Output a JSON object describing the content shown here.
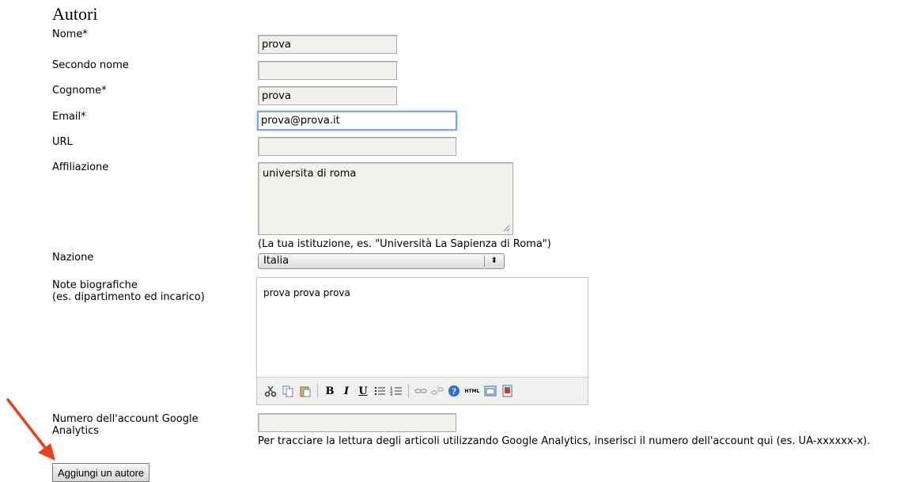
{
  "section": {
    "title": "Autori"
  },
  "fields": {
    "first_name": {
      "label": "Nome*",
      "value": "prova"
    },
    "middle_name": {
      "label": "Secondo nome",
      "value": ""
    },
    "last_name": {
      "label": "Cognome*",
      "value": "prova"
    },
    "email": {
      "label": "Email*",
      "value": "prova@prova.it"
    },
    "url": {
      "label": "URL",
      "value": ""
    },
    "affiliation": {
      "label": "Affiliazione",
      "value": "universita di roma",
      "hint": "(La tua istituzione, es. \"Università La Sapienza di Roma\")"
    },
    "country": {
      "label": "Nazione",
      "selected": "Italia"
    },
    "bio": {
      "label_line1": "Note biografiche",
      "label_line2": "(es. dipartimento ed incarico)",
      "value": "prova prova prova"
    },
    "analytics": {
      "label_line1": "Numero dell'account Google",
      "label_line2": "Analytics",
      "value": "",
      "hint": "Per tracciare la lettura degli articoli utilizzando Google Analytics, inserisci il numero dell'account qui (es. UA-xxxxxx-x)."
    }
  },
  "editor_toolbar": {
    "icons": [
      "cut-icon",
      "copy-icon",
      "paste-icon",
      "bold-icon",
      "italic-icon",
      "underline-icon",
      "bullet-list-icon",
      "numbered-list-icon",
      "link-icon",
      "unlink-icon",
      "help-icon",
      "html-icon",
      "fullscreen-icon",
      "insert-image-icon"
    ],
    "bold": "B",
    "italic": "I",
    "underline": "U",
    "html": "HTML"
  },
  "actions": {
    "add_author": "Aggiungi un autore"
  },
  "colors": {
    "focus_border": "#7fa7e0",
    "arrow": "#e8401c",
    "input_bg": "#f3f1ec"
  }
}
